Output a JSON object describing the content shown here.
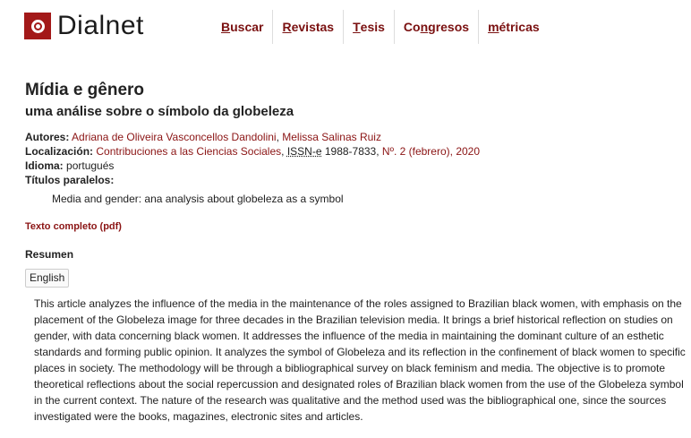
{
  "brand": {
    "name": "Dialnet",
    "color": "#a31919"
  },
  "nav": [
    {
      "pre": "",
      "ul": "B",
      "post": "uscar"
    },
    {
      "pre": "",
      "ul": "R",
      "post": "evistas"
    },
    {
      "pre": "",
      "ul": "T",
      "post": "esis"
    },
    {
      "pre": "Co",
      "ul": "n",
      "post": "gresos"
    },
    {
      "pre": "",
      "ul": "m",
      "post": "étricas"
    }
  ],
  "article": {
    "title": "Mídia e gênero",
    "subtitle": "uma análise sobre o símbolo da globeleza"
  },
  "meta": {
    "autores_label": "Autores:",
    "authors": [
      "Adriana de Oliveira Vasconcellos Dandolini",
      "Melissa Salinas Ruiz"
    ],
    "localizacion_label": "Localización:",
    "journal": "Contribuciones a las Ciencias Sociales",
    "issn_label": "ISSN-e",
    "issn": "1988-7833",
    "issue": "Nº. 2 (febrero), 2020",
    "idioma_label": "Idioma:",
    "idioma": "portugués",
    "titulos_label": "Títulos paralelos:",
    "parallel_title": "Media and gender: ana analysis about globeleza as a symbol"
  },
  "fulltext_link": "Texto completo (pdf)",
  "resumen": {
    "heading": "Resumen",
    "language_button": "English",
    "text": "This article analyzes the influence of the media in the maintenance of the roles assigned to Brazilian black women, with emphasis on the placement of the Globeleza image for three decades in the Brazilian television media. It brings a brief historical reflection on studies on gender, with data concerning black women. It addresses the influence of the media in maintaining the dominant culture of an esthetic standards and forming public opinion. It analyzes the symbol of Globeleza and its reflection in the confinement of black women to specific places in society. The methodology will be through a bibliographical survey on black feminism and media. The objective is to promote theoretical reflections about the social repercussion and designated roles of Brazilian black women from the use of the Globeleza symbol in the current context. The nature of the research was qualitative and the method used was the bibliographical one, since the sources investigated were the books, magazines, electronic sites and articles."
  }
}
